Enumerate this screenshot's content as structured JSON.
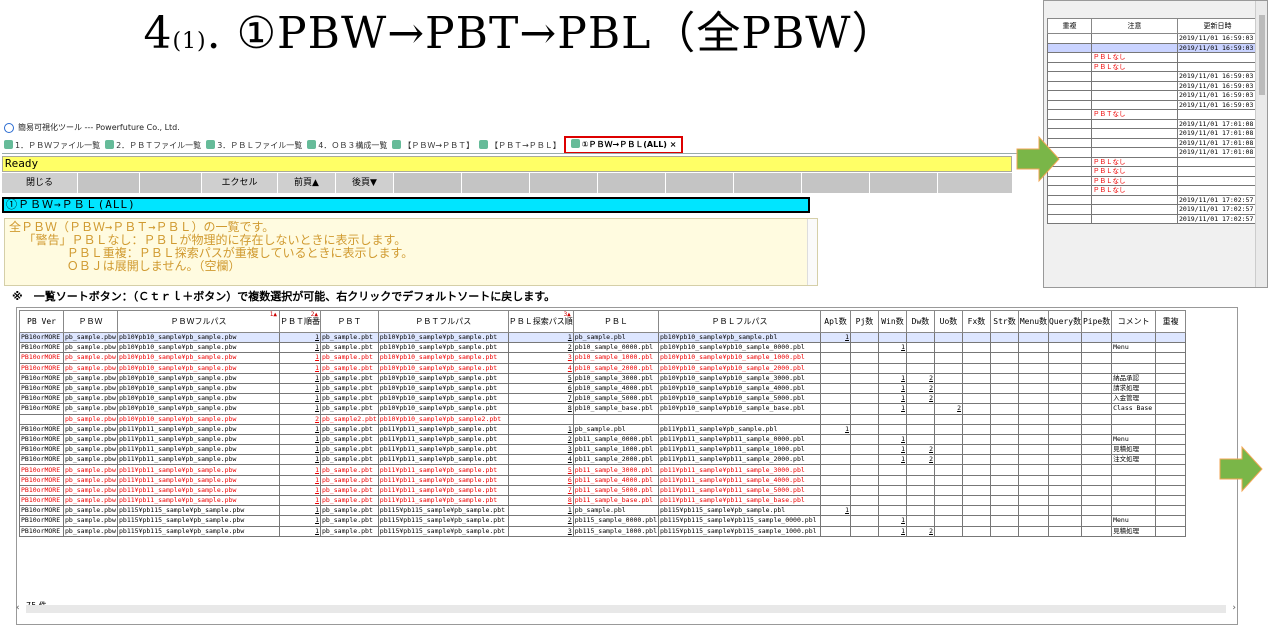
{
  "slide": {
    "title_main": "4",
    "title_sub": "(1)",
    "title_rest": ".  ①PBW→PBT→PBL（全PBW）"
  },
  "app": {
    "window_title": "簡易可視化ツール --- Powerfuture Co., Ltd.",
    "tabs": [
      {
        "label": "1．ＰＢＷファイル一覧",
        "active": false
      },
      {
        "label": "2．ＰＢＴファイル一覧",
        "active": false
      },
      {
        "label": "3．ＰＢＬファイル一覧",
        "active": false
      },
      {
        "label": "4．ＯＢ３構成一覧",
        "active": false
      },
      {
        "label": "【ＰＢＷ→ＰＢＴ】",
        "active": false
      },
      {
        "label": "【ＰＢＴ→ＰＢＬ】",
        "active": false
      },
      {
        "label": "①ＰＢＷ→ＰＢＬ(ALL)  ×",
        "active": true
      }
    ],
    "status": "Ready",
    "toolbar": {
      "close_label": "閉じる",
      "excel_label": "エクセル",
      "prev_label": "前頁▲",
      "next_label": "後頁▼"
    },
    "section_title": "①ＰＢＷ→ＰＢＬ(ALL)",
    "notes": [
      "全ＰＢＷ（ＰＢＷ→ＰＢＴ→ＰＢＬ）の一覧です。",
      "  「警告」ＰＢＬなし：ＰＢＬが物理的に存在しないときに表示します。",
      "        ＰＢＬ重複：ＰＢＬ探索パスが重複しているときに表示します。",
      "        ＯＢＪは展開しません。（空欄）"
    ],
    "sort_note": "※　一覧ソートボタン：（Ｃｔｒｌ＋ボタン）で複数選択が可能、右クリックでデフォルトソートに戻します。",
    "count_label": "75 件"
  },
  "grid": {
    "headers": [
      "PB Ver",
      "ＰＢＷ",
      "ＰＢＷフルパス",
      "ＰＢＴ順番",
      "ＰＢＴ",
      "ＰＢＴフルパス",
      "ＰＢＬ探索パス順",
      "ＰＢＬ",
      "ＰＢＬフルパス",
      "Apl数",
      "Pj数",
      "Win数",
      "Dw数",
      "Uo数",
      "Fx数",
      "Str数",
      "Menu数",
      "Query数",
      "Pipe数",
      "コメント",
      "重複"
    ],
    "sort_marks": {
      "2": "1▲",
      "3": "2▲",
      "6": "3▲"
    },
    "rows": [
      {
        "red": false,
        "sel": true,
        "c": [
          "PB10orMORE",
          "pb_sample.pbw",
          "pb10¥pb10_sample¥pb_sample.pbw",
          "1",
          "pb_sample.pbt",
          "pb10¥pb10_sample¥pb_sample.pbt",
          "1",
          "pb_sample.pbl",
          "pb10¥pb10_sample¥pb_sample.pbl",
          "1",
          "",
          "",
          "",
          "",
          "",
          "",
          "",
          "",
          "",
          "",
          ""
        ]
      },
      {
        "red": false,
        "sel": false,
        "c": [
          "PB10orMORE",
          "pb_sample.pbw",
          "pb10¥pb10_sample¥pb_sample.pbw",
          "1",
          "pb_sample.pbt",
          "pb10¥pb10_sample¥pb_sample.pbt",
          "2",
          "pb10_sample_0000.pbl",
          "pb10¥pb10_sample¥pb10_sample_0000.pbl",
          "",
          "",
          "1",
          "",
          "",
          "",
          "",
          "",
          "",
          "",
          "Menu",
          ""
        ]
      },
      {
        "red": true,
        "sel": false,
        "c": [
          "PB10orMORE",
          "pb_sample.pbw",
          "pb10¥pb10_sample¥pb_sample.pbw",
          "1",
          "pb_sample.pbt",
          "pb10¥pb10_sample¥pb_sample.pbt",
          "3",
          "pb10_sample_1000.pbl",
          "pb10¥pb10_sample¥pb10_sample_1000.pbl",
          "",
          "",
          "",
          "",
          "",
          "",
          "",
          "",
          "",
          "",
          "",
          ""
        ]
      },
      {
        "red": true,
        "sel": false,
        "c": [
          "PB10orMORE",
          "pb_sample.pbw",
          "pb10¥pb10_sample¥pb_sample.pbw",
          "1",
          "pb_sample.pbt",
          "pb10¥pb10_sample¥pb_sample.pbt",
          "4",
          "pb10_sample_2000.pbl",
          "pb10¥pb10_sample¥pb10_sample_2000.pbl",
          "",
          "",
          "",
          "",
          "",
          "",
          "",
          "",
          "",
          "",
          "",
          ""
        ]
      },
      {
        "red": false,
        "sel": false,
        "c": [
          "PB10orMORE",
          "pb_sample.pbw",
          "pb10¥pb10_sample¥pb_sample.pbw",
          "1",
          "pb_sample.pbt",
          "pb10¥pb10_sample¥pb_sample.pbt",
          "5",
          "pb10_sample_3000.pbl",
          "pb10¥pb10_sample¥pb10_sample_3000.pbl",
          "",
          "",
          "1",
          "2",
          "",
          "",
          "",
          "",
          "",
          "",
          "納品承認",
          ""
        ]
      },
      {
        "red": false,
        "sel": false,
        "c": [
          "PB10orMORE",
          "pb_sample.pbw",
          "pb10¥pb10_sample¥pb_sample.pbw",
          "1",
          "pb_sample.pbt",
          "pb10¥pb10_sample¥pb_sample.pbt",
          "6",
          "pb10_sample_4000.pbl",
          "pb10¥pb10_sample¥pb10_sample_4000.pbl",
          "",
          "",
          "1",
          "2",
          "",
          "",
          "",
          "",
          "",
          "",
          "請求処理",
          ""
        ]
      },
      {
        "red": false,
        "sel": false,
        "c": [
          "PB10orMORE",
          "pb_sample.pbw",
          "pb10¥pb10_sample¥pb_sample.pbw",
          "1",
          "pb_sample.pbt",
          "pb10¥pb10_sample¥pb_sample.pbt",
          "7",
          "pb10_sample_5000.pbl",
          "pb10¥pb10_sample¥pb10_sample_5000.pbl",
          "",
          "",
          "1",
          "2",
          "",
          "",
          "",
          "",
          "",
          "",
          "入金管理",
          ""
        ]
      },
      {
        "red": false,
        "sel": false,
        "c": [
          "PB10orMORE",
          "pb_sample.pbw",
          "pb10¥pb10_sample¥pb_sample.pbw",
          "1",
          "pb_sample.pbt",
          "pb10¥pb10_sample¥pb_sample.pbt",
          "8",
          "pb10_sample_base.pbl",
          "pb10¥pb10_sample¥pb10_sample_base.pbl",
          "",
          "",
          "1",
          "",
          "2",
          "",
          "",
          "",
          "",
          "",
          "Class Base",
          ""
        ]
      },
      {
        "red": true,
        "sel": false,
        "c": [
          "",
          "pb_sample.pbw",
          "pb10¥pb10_sample¥pb_sample.pbw",
          "2",
          "pb_sample2.pbt",
          "pb10¥pb10_sample¥pb_sample2.pbt",
          "",
          "",
          "",
          "",
          "",
          "",
          "",
          "",
          "",
          "",
          "",
          "",
          "",
          "",
          ""
        ]
      },
      {
        "red": false,
        "sel": false,
        "c": [
          "PB10orMORE",
          "pb_sample.pbw",
          "pb11¥pb11_sample¥pb_sample.pbw",
          "1",
          "pb_sample.pbt",
          "pb11¥pb11_sample¥pb_sample.pbt",
          "1",
          "pb_sample.pbl",
          "pb11¥pb11_sample¥pb_sample.pbl",
          "1",
          "",
          "",
          "",
          "",
          "",
          "",
          "",
          "",
          "",
          "",
          ""
        ]
      },
      {
        "red": false,
        "sel": false,
        "c": [
          "PB10orMORE",
          "pb_sample.pbw",
          "pb11¥pb11_sample¥pb_sample.pbw",
          "1",
          "pb_sample.pbt",
          "pb11¥pb11_sample¥pb_sample.pbt",
          "2",
          "pb11_sample_0000.pbl",
          "pb11¥pb11_sample¥pb11_sample_0000.pbl",
          "",
          "",
          "1",
          "",
          "",
          "",
          "",
          "",
          "",
          "",
          "Menu",
          ""
        ]
      },
      {
        "red": false,
        "sel": false,
        "c": [
          "PB10orMORE",
          "pb_sample.pbw",
          "pb11¥pb11_sample¥pb_sample.pbw",
          "1",
          "pb_sample.pbt",
          "pb11¥pb11_sample¥pb_sample.pbt",
          "3",
          "pb11_sample_1000.pbl",
          "pb11¥pb11_sample¥pb11_sample_1000.pbl",
          "",
          "",
          "1",
          "2",
          "",
          "",
          "",
          "",
          "",
          "",
          "見積処理",
          ""
        ]
      },
      {
        "red": false,
        "sel": false,
        "c": [
          "PB10orMORE",
          "pb_sample.pbw",
          "pb11¥pb11_sample¥pb_sample.pbw",
          "1",
          "pb_sample.pbt",
          "pb11¥pb11_sample¥pb_sample.pbt",
          "4",
          "pb11_sample_2000.pbl",
          "pb11¥pb11_sample¥pb11_sample_2000.pbl",
          "",
          "",
          "1",
          "2",
          "",
          "",
          "",
          "",
          "",
          "",
          "注文処理",
          ""
        ]
      },
      {
        "red": true,
        "sel": false,
        "c": [
          "PB10orMORE",
          "pb_sample.pbw",
          "pb11¥pb11_sample¥pb_sample.pbw",
          "1",
          "pb_sample.pbt",
          "pb11¥pb11_sample¥pb_sample.pbt",
          "5",
          "pb11_sample_3000.pbl",
          "pb11¥pb11_sample¥pb11_sample_3000.pbl",
          "",
          "",
          "",
          "",
          "",
          "",
          "",
          "",
          "",
          "",
          "",
          ""
        ]
      },
      {
        "red": true,
        "sel": false,
        "c": [
          "PB10orMORE",
          "pb_sample.pbw",
          "pb11¥pb11_sample¥pb_sample.pbw",
          "1",
          "pb_sample.pbt",
          "pb11¥pb11_sample¥pb_sample.pbt",
          "6",
          "pb11_sample_4000.pbl",
          "pb11¥pb11_sample¥pb11_sample_4000.pbl",
          "",
          "",
          "",
          "",
          "",
          "",
          "",
          "",
          "",
          "",
          "",
          ""
        ]
      },
      {
        "red": true,
        "sel": false,
        "c": [
          "PB10orMORE",
          "pb_sample.pbw",
          "pb11¥pb11_sample¥pb_sample.pbw",
          "1",
          "pb_sample.pbt",
          "pb11¥pb11_sample¥pb_sample.pbt",
          "7",
          "pb11_sample_5000.pbl",
          "pb11¥pb11_sample¥pb11_sample_5000.pbl",
          "",
          "",
          "",
          "",
          "",
          "",
          "",
          "",
          "",
          "",
          "",
          ""
        ]
      },
      {
        "red": true,
        "sel": false,
        "c": [
          "PB10orMORE",
          "pb_sample.pbw",
          "pb11¥pb11_sample¥pb_sample.pbw",
          "1",
          "pb_sample.pbt",
          "pb11¥pb11_sample¥pb_sample.pbt",
          "8",
          "pb11_sample_base.pbl",
          "pb11¥pb11_sample¥pb11_sample_base.pbl",
          "",
          "",
          "",
          "",
          "",
          "",
          "",
          "",
          "",
          "",
          "",
          ""
        ]
      },
      {
        "red": false,
        "sel": false,
        "c": [
          "PB10orMORE",
          "pb_sample.pbw",
          "pb115¥pb115_sample¥pb_sample.pbw",
          "1",
          "pb_sample.pbt",
          "pb115¥pb115_sample¥pb_sample.pbt",
          "1",
          "pb_sample.pbl",
          "pb115¥pb115_sample¥pb_sample.pbl",
          "1",
          "",
          "",
          "",
          "",
          "",
          "",
          "",
          "",
          "",
          "",
          ""
        ]
      },
      {
        "red": false,
        "sel": false,
        "c": [
          "PB10orMORE",
          "pb_sample.pbw",
          "pb115¥pb115_sample¥pb_sample.pbw",
          "1",
          "pb_sample.pbt",
          "pb115¥pb115_sample¥pb_sample.pbt",
          "2",
          "pb115_sample_0000.pbl",
          "pb115¥pb115_sample¥pb115_sample_0000.pbl",
          "",
          "",
          "1",
          "",
          "",
          "",
          "",
          "",
          "",
          "",
          "Menu",
          ""
        ]
      },
      {
        "red": false,
        "sel": false,
        "c": [
          "PB10orMORE",
          "pb_sample.pbw",
          "pb115¥pb115_sample¥pb_sample.pbw",
          "1",
          "pb_sample.pbt",
          "pb115¥pb115_sample¥pb_sample.pbt",
          "3",
          "pb115_sample_1000.pbl",
          "pb115¥pb115_sample¥pb115_sample_1000.pbl",
          "",
          "",
          "1",
          "2",
          "",
          "",
          "",
          "",
          "",
          "",
          "見積処理",
          ""
        ]
      }
    ]
  },
  "inset": {
    "headers": [
      "重複",
      "注意",
      "更新日時"
    ],
    "rows": [
      {
        "sel": false,
        "c": [
          "",
          "",
          "2019/11/01 16:59:03"
        ]
      },
      {
        "sel": true,
        "c": [
          "",
          "",
          "2019/11/01 16:59:03"
        ]
      },
      {
        "sel": false,
        "c": [
          "",
          "ＰＢＬなし",
          ""
        ]
      },
      {
        "sel": false,
        "c": [
          "",
          "ＰＢＬなし",
          ""
        ]
      },
      {
        "sel": false,
        "c": [
          "",
          "",
          "2019/11/01 16:59:03"
        ]
      },
      {
        "sel": false,
        "c": [
          "",
          "",
          "2019/11/01 16:59:03"
        ]
      },
      {
        "sel": false,
        "c": [
          "",
          "",
          "2019/11/01 16:59:03"
        ]
      },
      {
        "sel": false,
        "c": [
          "",
          "",
          "2019/11/01 16:59:03"
        ]
      },
      {
        "sel": false,
        "c": [
          "",
          "ＰＢＴなし",
          ""
        ]
      },
      {
        "sel": false,
        "c": [
          "",
          "",
          "2019/11/01 17:01:08"
        ]
      },
      {
        "sel": false,
        "c": [
          "",
          "",
          "2019/11/01 17:01:08"
        ]
      },
      {
        "sel": false,
        "c": [
          "",
          "",
          "2019/11/01 17:01:08"
        ]
      },
      {
        "sel": false,
        "c": [
          "",
          "",
          "2019/11/01 17:01:08"
        ]
      },
      {
        "sel": false,
        "c": [
          "",
          "ＰＢＬなし",
          ""
        ]
      },
      {
        "sel": false,
        "c": [
          "",
          "ＰＢＬなし",
          ""
        ]
      },
      {
        "sel": false,
        "c": [
          "",
          "ＰＢＬなし",
          ""
        ]
      },
      {
        "sel": false,
        "c": [
          "",
          "ＰＢＬなし",
          ""
        ]
      },
      {
        "sel": false,
        "c": [
          "",
          "",
          "2019/11/01 17:02:57"
        ]
      },
      {
        "sel": false,
        "c": [
          "",
          "",
          "2019/11/01 17:02:57"
        ]
      },
      {
        "sel": false,
        "c": [
          "",
          "",
          "2019/11/01 17:02:57"
        ]
      }
    ]
  },
  "colors": {
    "ready_bg": "#ffff66",
    "section_bg": "#00e5ff",
    "warning_text": "#ee0000",
    "arrow": "#7ab648",
    "notes_text": "#d09a30"
  }
}
